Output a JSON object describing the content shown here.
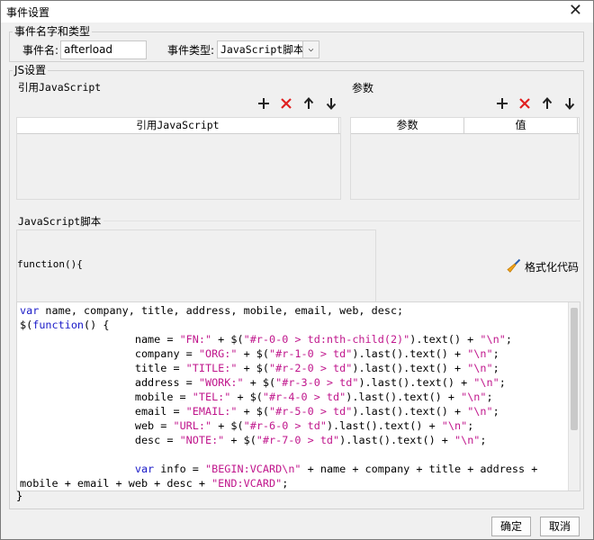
{
  "window": {
    "title": "事件设置",
    "close_glyph": "✕"
  },
  "event_section": {
    "legend": "事件名字和类型",
    "name_label": "事件名:",
    "name_value": "afterload",
    "type_label": "事件类型:",
    "type_value": "JavaScript脚本"
  },
  "js_section": {
    "legend": "JS设置",
    "ref_title": "引用JavaScript",
    "ref_column": "引用JavaScript",
    "param_title": "参数",
    "param_columns": [
      "参数",
      "值"
    ],
    "script_title": "JavaScript脚本",
    "function_header": "function(){",
    "format_label": "格式化代码",
    "closing_brace": "}"
  },
  "toolbar_icons": [
    "add-icon",
    "delete-icon",
    "move-up-icon",
    "move-down-icon"
  ],
  "code_lines": [
    [
      [
        "kw",
        "var"
      ],
      [
        "t",
        " name, company, title, address, mobile, email, web, desc;"
      ]
    ],
    [
      [
        "t",
        "$("
      ],
      [
        "kw",
        "function"
      ],
      [
        "t",
        "() {"
      ]
    ],
    [
      [
        "t",
        "                  name = "
      ],
      [
        "st",
        "\"FN:\""
      ],
      [
        "t",
        " + $("
      ],
      [
        "st",
        "\"#r-0-0 > td:nth-child(2)\""
      ],
      [
        "t",
        ").text() + "
      ],
      [
        "st",
        "\"\\n\""
      ],
      [
        "t",
        ";"
      ]
    ],
    [
      [
        "t",
        "                  company = "
      ],
      [
        "st",
        "\"ORG:\""
      ],
      [
        "t",
        " + $("
      ],
      [
        "st",
        "\"#r-1-0 > td\""
      ],
      [
        "t",
        ").last().text() + "
      ],
      [
        "st",
        "\"\\n\""
      ],
      [
        "t",
        ";"
      ]
    ],
    [
      [
        "t",
        "                  title = "
      ],
      [
        "st",
        "\"TITLE:\""
      ],
      [
        "t",
        " + $("
      ],
      [
        "st",
        "\"#r-2-0 > td\""
      ],
      [
        "t",
        ").last().text() + "
      ],
      [
        "st",
        "\"\\n\""
      ],
      [
        "t",
        ";"
      ]
    ],
    [
      [
        "t",
        "                  address = "
      ],
      [
        "st",
        "\"WORK:\""
      ],
      [
        "t",
        " + $("
      ],
      [
        "st",
        "\"#r-3-0 > td\""
      ],
      [
        "t",
        ").last().text() + "
      ],
      [
        "st",
        "\"\\n\""
      ],
      [
        "t",
        ";"
      ]
    ],
    [
      [
        "t",
        "                  mobile = "
      ],
      [
        "st",
        "\"TEL:\""
      ],
      [
        "t",
        " + $("
      ],
      [
        "st",
        "\"#r-4-0 > td\""
      ],
      [
        "t",
        ").last().text() + "
      ],
      [
        "st",
        "\"\\n\""
      ],
      [
        "t",
        ";"
      ]
    ],
    [
      [
        "t",
        "                  email = "
      ],
      [
        "st",
        "\"EMAIL:\""
      ],
      [
        "t",
        " + $("
      ],
      [
        "st",
        "\"#r-5-0 > td\""
      ],
      [
        "t",
        ").last().text() + "
      ],
      [
        "st",
        "\"\\n\""
      ],
      [
        "t",
        ";"
      ]
    ],
    [
      [
        "t",
        "                  web = "
      ],
      [
        "st",
        "\"URL:\""
      ],
      [
        "t",
        " + $("
      ],
      [
        "st",
        "\"#r-6-0 > td\""
      ],
      [
        "t",
        ").last().text() + "
      ],
      [
        "st",
        "\"\\n\""
      ],
      [
        "t",
        ";"
      ]
    ],
    [
      [
        "t",
        "                  desc = "
      ],
      [
        "st",
        "\"NOTE:\""
      ],
      [
        "t",
        " + $("
      ],
      [
        "st",
        "\"#r-7-0 > td\""
      ],
      [
        "t",
        ").last().text() + "
      ],
      [
        "st",
        "\"\\n\""
      ],
      [
        "t",
        ";"
      ]
    ],
    [
      [
        "t",
        ""
      ]
    ],
    [
      [
        "t",
        "                  "
      ],
      [
        "kw",
        "var"
      ],
      [
        "t",
        " info = "
      ],
      [
        "st",
        "\"BEGIN:VCARD\\n\""
      ],
      [
        "t",
        " + name + company + title + address +"
      ]
    ],
    [
      [
        "t",
        "mobile + email + web + desc + "
      ],
      [
        "st",
        "\"END:VCARD\""
      ],
      [
        "t",
        ";"
      ]
    ]
  ],
  "buttons": {
    "ok": "确定",
    "cancel": "取消"
  },
  "colors": {
    "delete_icon": "#e02020",
    "keyword": "#1a1ac8",
    "string": "#c0168c"
  }
}
